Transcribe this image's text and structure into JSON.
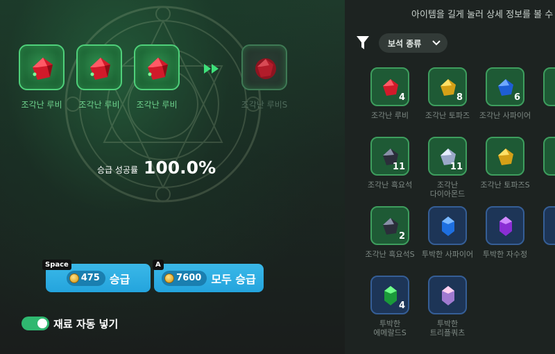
{
  "upgrade": {
    "materials": [
      {
        "name": "조각난 루비"
      },
      {
        "name": "조각난 루비"
      },
      {
        "name": "조각난 루비"
      }
    ],
    "result": {
      "name": "조각난 루비S"
    },
    "success_rate_label": "승급 성공률",
    "success_rate_value": "100.0%",
    "upgrade_button": {
      "key": "Space",
      "cost": "475",
      "label": "승급"
    },
    "upgrade_all_button": {
      "key": "A",
      "cost": "7600",
      "label": "모두 승급"
    },
    "auto_fill": {
      "label": "재료 자동 넣기",
      "enabled": true
    }
  },
  "inventory": {
    "hint": "아이템을 길게 눌러 상세 정보를 볼 수",
    "sort_label": "보석 종류",
    "items": [
      {
        "name": "조각난 루비",
        "count": "4",
        "gem": "ruby",
        "frame": "green"
      },
      {
        "name": "조각난 토파즈",
        "count": "8",
        "gem": "topaz",
        "frame": "green"
      },
      {
        "name": "조각난 사파이어",
        "count": "6",
        "gem": "sapphire",
        "frame": "green"
      },
      {
        "name": "조각",
        "count": "",
        "gem": "",
        "frame": "green"
      },
      {
        "name": "조각난 흑요석",
        "count": "11",
        "gem": "obsidian",
        "frame": "green"
      },
      {
        "name": "조각난\n다이아몬드",
        "count": "11",
        "gem": "diamond",
        "frame": "green"
      },
      {
        "name": "조각난 토파즈S",
        "count": "",
        "gem": "topaz",
        "frame": "green"
      },
      {
        "name": "조\n사",
        "count": "",
        "gem": "",
        "frame": "green"
      },
      {
        "name": "조각난 흑요석S",
        "count": "2",
        "gem": "obsidian",
        "frame": "green"
      },
      {
        "name": "투박한 사파이어",
        "count": "",
        "gem": "sapphire-crystal",
        "frame": "blue"
      },
      {
        "name": "투박한 자수정",
        "count": "",
        "gem": "amethyst-crystal",
        "frame": "blue"
      },
      {
        "name": "투박",
        "count": "",
        "gem": "",
        "frame": "blue"
      },
      {
        "name": "투박한\n에메랄드S",
        "count": "4",
        "gem": "emerald-crystal",
        "frame": "blue"
      },
      {
        "name": "투박한\n트리플쿼츠",
        "count": "",
        "gem": "quartz-crystal",
        "frame": "blue"
      }
    ]
  },
  "colors": {
    "accent_blue": "#2aaee4",
    "accent_green": "#4fd07a",
    "toggle_on": "#2fb870"
  }
}
